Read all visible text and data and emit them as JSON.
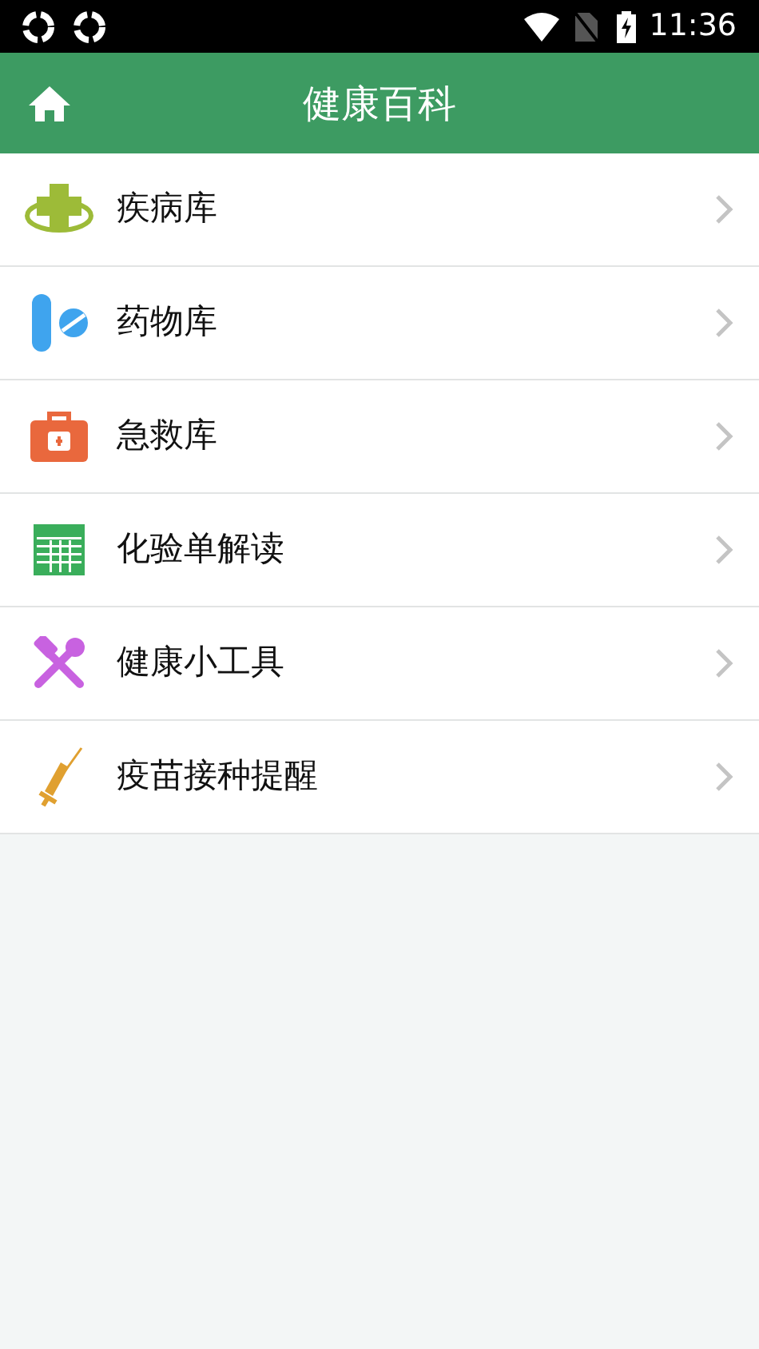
{
  "status_bar": {
    "time": "11:36"
  },
  "header": {
    "title": "健康百科"
  },
  "menu": [
    {
      "label": "疾病库",
      "kind": "disease"
    },
    {
      "label": "药物库",
      "kind": "drug"
    },
    {
      "label": "急救库",
      "kind": "firstaid"
    },
    {
      "label": "化验单解读",
      "kind": "lab"
    },
    {
      "label": "健康小工具",
      "kind": "tools"
    },
    {
      "label": "疫苗接种提醒",
      "kind": "vaccine"
    }
  ]
}
